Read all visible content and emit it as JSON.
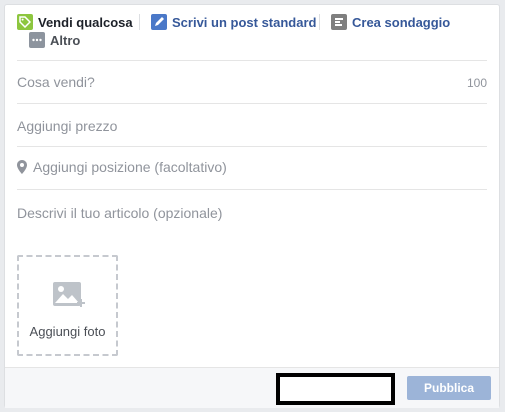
{
  "tabs": {
    "sell": {
      "label": "Vendi qualcosa",
      "icon": "tag-icon"
    },
    "post": {
      "label": "Scrivi un post standard",
      "icon": "pencil-icon"
    },
    "poll": {
      "label": "Crea sondaggio",
      "icon": "poll-icon"
    },
    "more": {
      "label": "Altro",
      "icon": "more-icon"
    }
  },
  "form": {
    "what_placeholder": "Cosa vendi?",
    "what_counter": "100",
    "price_placeholder": "Aggiungi prezzo",
    "location_placeholder": "Aggiungi posizione (facoltativo)",
    "location_icon": "location-pin-icon",
    "description_placeholder": "Descrivi il tuo articolo (opzionale)"
  },
  "photo": {
    "label": "Aggiungi foto",
    "icon": "add-photo-icon"
  },
  "footer": {
    "publish_label": "Pubblica"
  },
  "colors": {
    "accent": "#365899",
    "publish_disabled": "#9cb4d8",
    "sell_icon": "#8dc63f"
  }
}
